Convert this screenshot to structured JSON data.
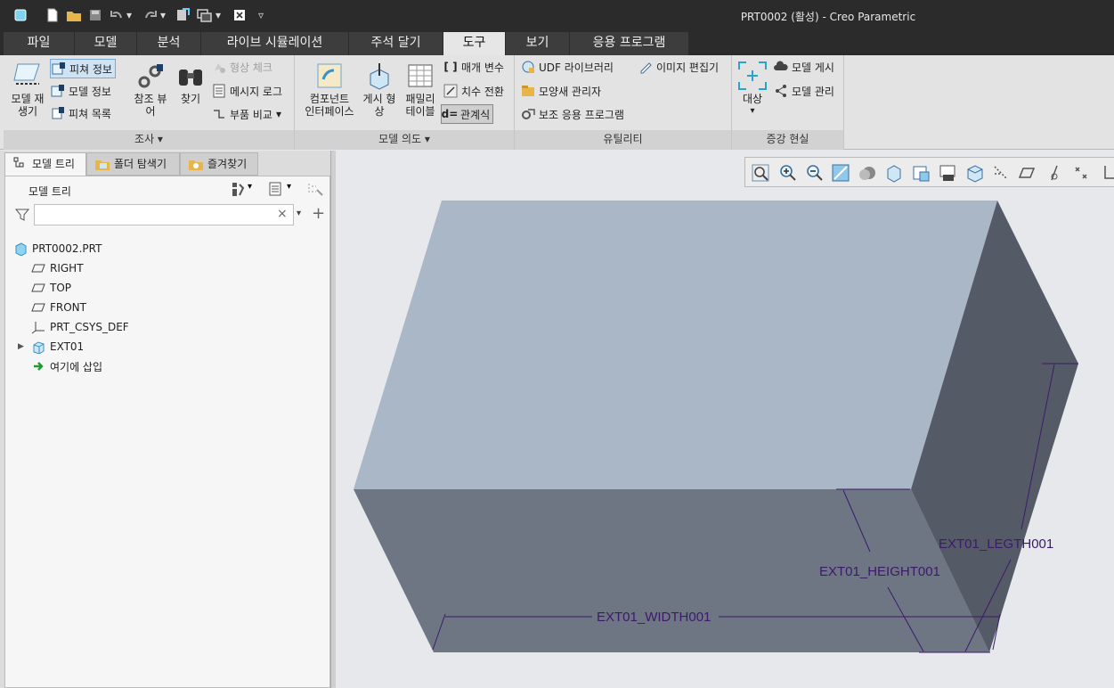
{
  "window": {
    "title": "PRT0002 (활성) - Creo Parametric"
  },
  "quick_access": [
    "app-icon",
    "new-icon",
    "open-icon",
    "save-icon",
    "undo-icon",
    "redo-icon",
    "regenerate-icon",
    "windows-icon",
    "close-window-icon",
    "customize-icon"
  ],
  "menu_tabs": [
    {
      "label": "파일",
      "active": false
    },
    {
      "label": "모델",
      "active": false
    },
    {
      "label": "분석",
      "active": false
    },
    {
      "label": "라이브 시뮬레이션",
      "active": false
    },
    {
      "label": "주석 달기",
      "active": false
    },
    {
      "label": "도구",
      "active": true
    },
    {
      "label": "보기",
      "active": false
    },
    {
      "label": "응용 프로그램",
      "active": false
    }
  ],
  "ribbon": {
    "investigate": {
      "group_label": "조사 ▾",
      "regen_model": "모델 재\n생기",
      "feature_info": "피쳐 정보",
      "model_info": "모델 정보",
      "feature_list": "피쳐 목록",
      "reference_viewer": "참조 뷰\n어",
      "find": "찾기",
      "geometry_check": "형상 체크",
      "message_log": "메시지 로그",
      "compare_part": "부품 비교"
    },
    "model_intent": {
      "group_label": "모델 의도 ▾",
      "component_interface": "컴포넌트\n인터페이스",
      "publish_geometry": "게시 형\n상",
      "family_table": "패밀리\n테이블",
      "parameters": "매개 변수",
      "switch_dimensions": "치수 전환",
      "relations": "관계식"
    },
    "utilities": {
      "group_label": "유틸리티",
      "udf_library": "UDF 라이브러리",
      "image_editor": "이미지 편집기",
      "appearance_manager": "모양새 관리자",
      "auxiliary_apps": "보조 응용 프로그램"
    },
    "ar": {
      "group_label": "증강 현실",
      "target": "대상",
      "publish_model": "모델 게시",
      "manage_models": "모델 관리"
    }
  },
  "left_tabs": [
    "모델 트리",
    "폴더 탐색기",
    "즐겨찾기"
  ],
  "model_tree": {
    "header": "모델 트리",
    "filter_value": "",
    "items": [
      {
        "label": "PRT0002.PRT",
        "icon": "part-icon"
      },
      {
        "label": "RIGHT",
        "icon": "datum-plane-icon"
      },
      {
        "label": "TOP",
        "icon": "datum-plane-icon"
      },
      {
        "label": "FRONT",
        "icon": "datum-plane-icon"
      },
      {
        "label": "PRT_CSYS_DEF",
        "icon": "csys-icon"
      },
      {
        "label": "EXT01",
        "icon": "extrude-icon"
      },
      {
        "label": "여기에 삽입",
        "icon": "insert-here-icon"
      }
    ]
  },
  "dimensions": {
    "width": "EXT01_WIDTH001",
    "height": "EXT01_HEIGHT001",
    "length": "EXT01_LEGTH001"
  },
  "colors": {
    "top_face": "#a9b7c7",
    "front_face": "#6e7683",
    "side_face": "#555b66",
    "dimension": "#3c1a6b",
    "titlebar": "#2b2b2b"
  }
}
